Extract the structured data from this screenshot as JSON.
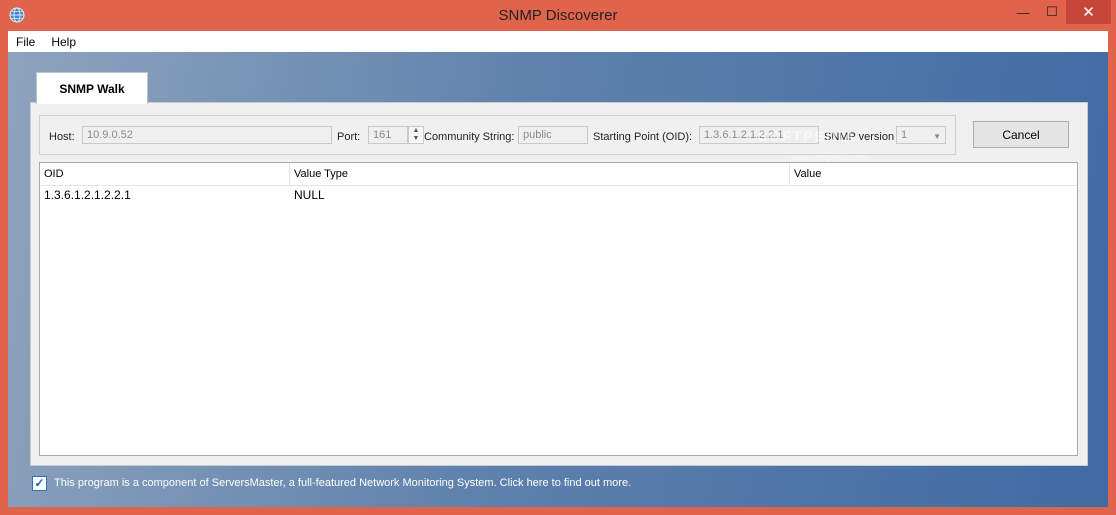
{
  "window": {
    "title": "SNMP Discoverer",
    "minimize_glyph": "—",
    "maximize_glyph": "☐",
    "close_glyph": "✕",
    "icon": "globe-icon"
  },
  "menu": {
    "items": [
      "File",
      "Help"
    ]
  },
  "tab": {
    "label": "SNMP Walk"
  },
  "params": {
    "host_label": "Host:",
    "host_value": "10.9.0.52",
    "port_label": "Port:",
    "port_value": "161",
    "community_label": "Community String:",
    "community_value": "public",
    "oid_label": "Starting Point (OID):",
    "oid_value": "1.3.6.1.2.1.2.2.1",
    "version_label": "SNMP version",
    "version_value": "1"
  },
  "actions": {
    "cancel_label": "Cancel"
  },
  "table": {
    "columns": [
      "OID",
      "Value Type",
      "Value"
    ],
    "rows": [
      {
        "oid": "1.3.6.1.2.1.2.2.1",
        "value_type": "NULL",
        "value": ""
      }
    ]
  },
  "footer": {
    "text": "This program is a component of ServersMaster, a full-featured Network Monitoring System. Click here to find out more.",
    "checked": true
  },
  "watermark": {
    "text": "SOFTPEDIA",
    "sub": "www.softpedia.com"
  },
  "colors": {
    "titlebar": "#e0644c",
    "close_button": "#c7463a",
    "content_gradient_start": "#8ea4bd",
    "content_gradient_end": "#3f6aa2"
  }
}
